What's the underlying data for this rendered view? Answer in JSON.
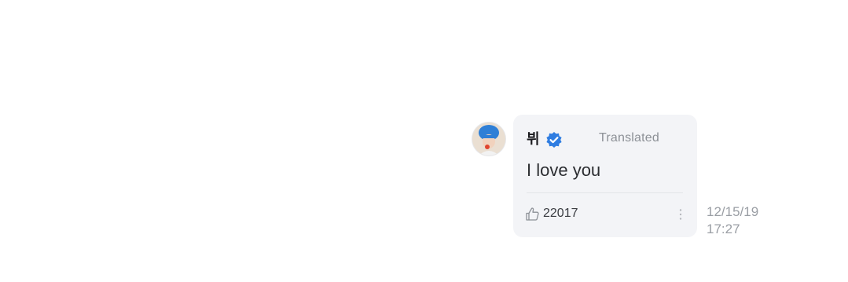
{
  "comment": {
    "author": "뷔",
    "verified_icon": "verified-badge-icon",
    "translated_label": "Translated",
    "message": "I love you",
    "like_icon": "thumbs-up-icon",
    "like_count": "22017",
    "more_icon": "vertical-ellipsis-icon",
    "timestamp_date": "12/15/19",
    "timestamp_time": "17:27"
  },
  "colors": {
    "bubble_background": "#f3f4f7",
    "verified_badge": "#2f7de1",
    "secondary_text": "#8c9096",
    "primary_text": "#2b2d31"
  }
}
